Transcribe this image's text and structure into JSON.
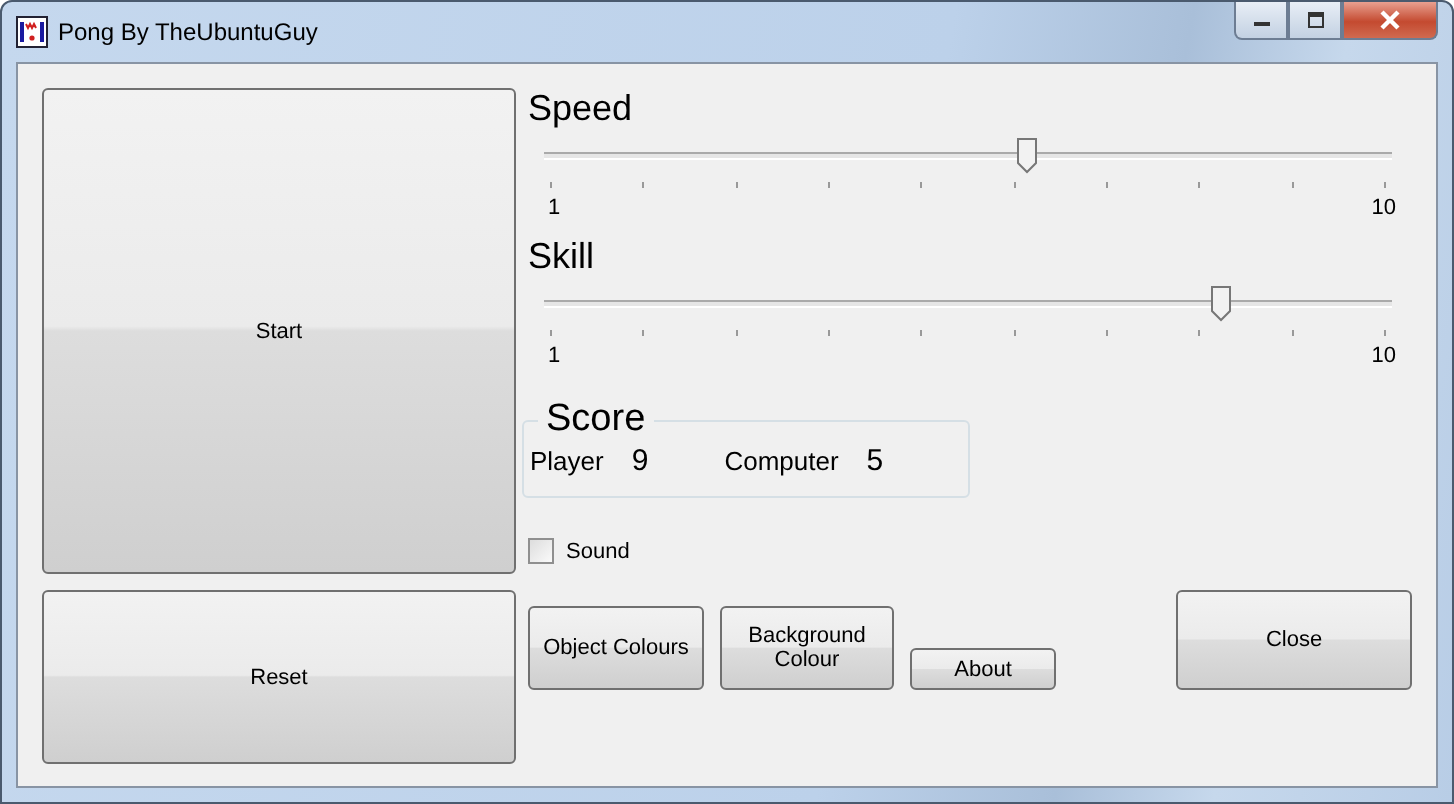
{
  "window": {
    "title": "Pong By TheUbuntuGuy"
  },
  "buttons": {
    "start": "Start",
    "reset": "Reset",
    "object_colours": "Object Colours",
    "background_colour": "Background Colour",
    "about": "About",
    "close": "Close"
  },
  "sliders": [
    {
      "label": "Speed",
      "level": 0.556,
      "min_label": "1",
      "max_label": "10"
    },
    {
      "label": "Skill",
      "level": 0.778,
      "min_label": "1",
      "max_label": "10"
    }
  ],
  "score": {
    "title": "Score",
    "player_label": "Player",
    "player_value": "9",
    "computer_label": "Computer",
    "computer_value": "5"
  },
  "sound": {
    "label": "Sound",
    "checked": false
  }
}
